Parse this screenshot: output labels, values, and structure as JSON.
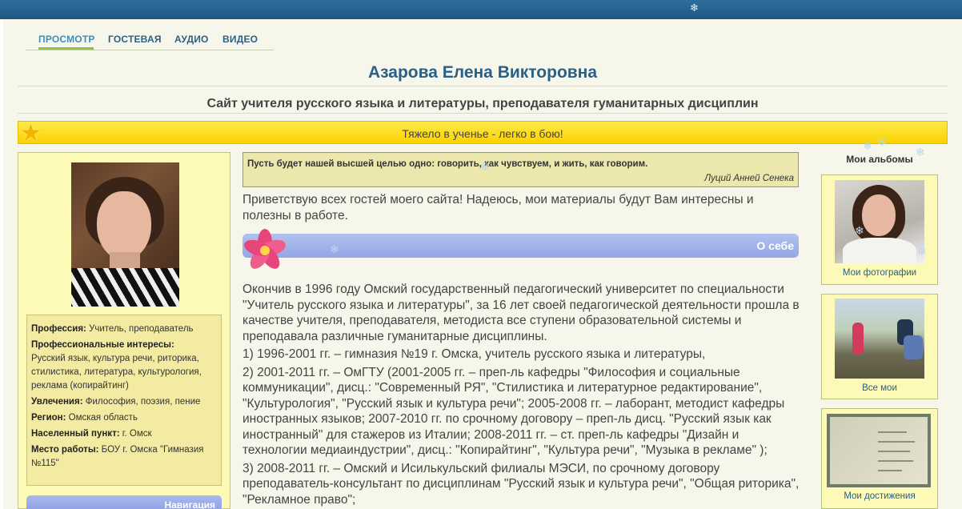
{
  "nav": {
    "items": [
      "ПРОСМОТР",
      "ГОСТЕВАЯ",
      "АУДИО",
      "ВИДЕО"
    ]
  },
  "site": {
    "title": "Азарова Елена Викторовна",
    "subtitle": "Сайт учителя русского языка и литературы, преподавателя гуманитарных дисциплин",
    "motto": "Тяжело в ученье - легко в бою!"
  },
  "profile": {
    "profession_label": "Профессия:",
    "profession_value": "Учитель, преподаватель",
    "interests_label": "Профессиональные интересы:",
    "interests_value": "Русский язык, культура речи, риторика, стилистика, литература, культурология, реклама (копирайтинг)",
    "hobbies_label": "Увлечения:",
    "hobbies_value": "Философия, поэзия, пение",
    "region_label": "Регион:",
    "region_value": "Омская область",
    "city_label": "Населенный пункт:",
    "city_value": "г. Омск",
    "work_label": "Место работы:",
    "work_value": "БОУ г. Омска \"Гимназия №115\"",
    "bottom_button": "Навигация"
  },
  "quote": {
    "text": "Пусть будет нашей высшей целью одно: говорить, как чувствуем, и жить, как говорим.",
    "author": "Луций Анней Сенека"
  },
  "main": {
    "greeting": "Приветствую всех гостей моего сайта! Надеюсь, мои материалы будут Вам интересны и полезны в работе.",
    "about_title": "О себе",
    "paragraphs": [
      "Окончив в 1996 году Омский государственный педагогический университет  по специальности \"Учитель русского языка и литературы\", за 16 лет своей педагогической деятельности прошла в качестве учителя, преподавателя, методиста  все ступени образовательной системы и преподавала различные гуманитарные дисциплины.",
      "1) 1996-2001 гг. – гимназия №19 г. Омска, учитель русского языка и литературы,",
      "2) 2001-2011 гг.  – ОмГТУ (2001-2005 гг. – преп-ль кафедры \"Философия и социальные коммуникации\", дисц.: \"Современный РЯ\", \"Стилистика и литературное редактирование\", \"Культурология\", \"Русский язык и культура речи\"; 2005-2008 гг. – лаборант, методист кафедры иностранных языков; 2007-2010 гг. по срочному договору – преп-ль дисц. \"Русский язык как иностранный\" для стажеров из Италии; 2008-2011 гг. – ст. преп-ль кафедры \"Дизайн и технологии медиаиндустрии\", дисц.: \"Копирайтинг\", \"Культура речи\", \"Музыка в рекламе\" );",
      "3) 2008-2011 гг.  – Омский и Исилькульский филиалы МЭСИ, по срочному договору преподаватель-консультант по дисциплинам \"Русский язык и культура речи\", \"Общая риторика\", \"Рекламное право\";"
    ]
  },
  "albums": {
    "title": "Мои альбомы",
    "items": [
      "Мои фотографии",
      "Все мои",
      "Мои достижения"
    ]
  }
}
